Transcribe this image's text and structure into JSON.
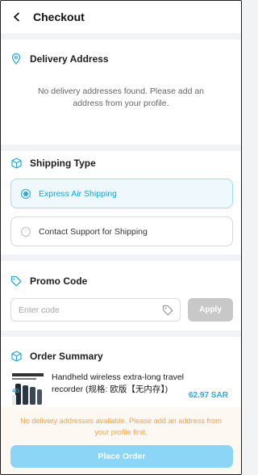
{
  "header": {
    "title": "Checkout",
    "back_icon": "chevron-left-icon"
  },
  "delivery": {
    "title": "Delivery Address",
    "icon": "location-pin-icon",
    "message": "No delivery addresses found. Please add an address from your profile."
  },
  "shipping": {
    "title": "Shipping Type",
    "icon": "box-icon",
    "options": [
      {
        "label": "Express Air Shipping",
        "selected": true
      },
      {
        "label": "Contact Support for Shipping",
        "selected": false
      }
    ]
  },
  "promo": {
    "title": "Promo Code",
    "icon": "tag-icon",
    "placeholder": "Enter code",
    "value": "",
    "apply_label": "Apply"
  },
  "summary": {
    "title": "Order Summary",
    "icon": "box-icon",
    "items": [
      {
        "name": "Handheld wireless extra-long travel recorder (规格: 欧版【无内存】)",
        "price": "62.97 SAR",
        "image_label": "4G"
      }
    ]
  },
  "footer": {
    "warning": "No delivery addresses available. Please add an address from your profile first.",
    "place_order_label": "Place Order"
  },
  "colors": {
    "accent": "#2aa9e0",
    "selected_bg": "#eef8fd",
    "warning": "#f0a54c",
    "disabled_button": "#c8c8c8",
    "place_order_button": "#8dd5f6"
  }
}
